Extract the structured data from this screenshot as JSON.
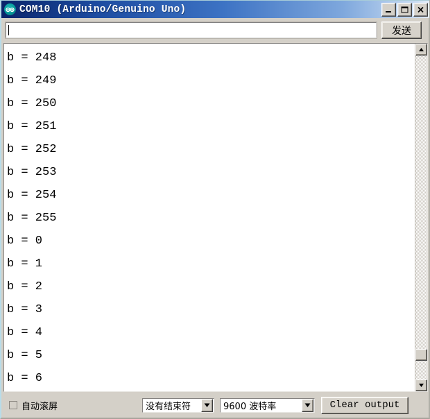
{
  "window": {
    "title": "COM10 (Arduino/Genuino Uno)",
    "icon": "arduino-logo-icon",
    "controls": {
      "minimize": "minimize-icon",
      "maximize": "maximize-icon",
      "close": "close-icon"
    },
    "titlebar_gradient_start": "#0a246a",
    "titlebar_gradient_end": "#e8f0fa"
  },
  "send_bar": {
    "input_value": "",
    "input_placeholder": "",
    "send_label": "发送"
  },
  "console": {
    "lines": [
      "b = 248",
      "b = 249",
      "b = 250",
      "b = 251",
      "b = 252",
      "b = 253",
      "b = 254",
      "b = 255",
      "b = 0",
      "b = 1",
      "b = 2",
      "b = 3",
      "b = 4",
      "b = 5",
      "b = 6"
    ],
    "text_color": "#000000",
    "background": "#ffffff"
  },
  "scrollbar": {
    "up_icon": "chevron-up-icon",
    "down_icon": "chevron-down-icon",
    "thumb": "scroll-thumb"
  },
  "status_bar": {
    "autoscroll_label": "自动滚屏",
    "autoscroll_checked": false,
    "line_ending_value": "没有结束符",
    "baud_value": "9600 波特率",
    "clear_label": "Clear output",
    "dropdown_icon": "chevron-down-icon"
  }
}
